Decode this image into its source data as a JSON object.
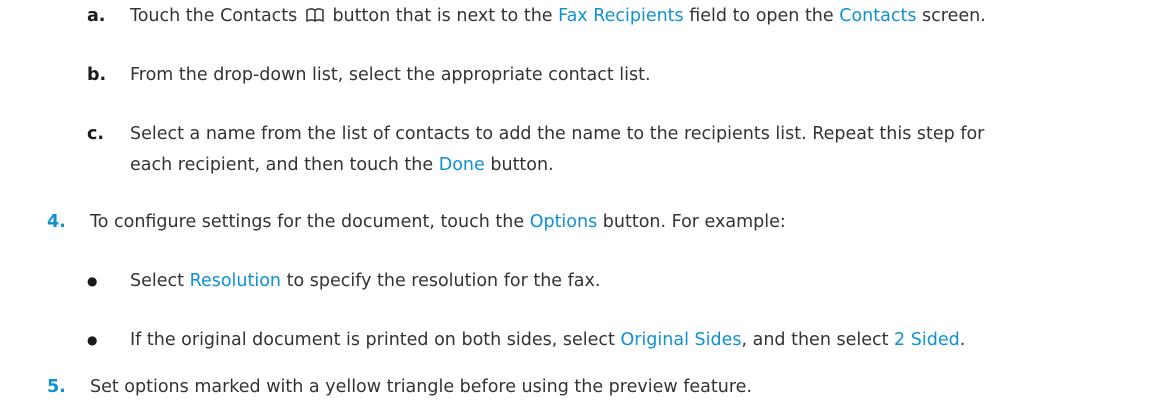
{
  "steps": {
    "a": {
      "marker": "a.",
      "t1": "Touch the Contacts",
      "t2": "button that is next to the",
      "link1": "Fax Recipients",
      "t3": "field to open the",
      "link2": "Contacts",
      "t4": "screen."
    },
    "b": {
      "marker": "b.",
      "text": "From the drop-down list, select the appropriate contact list."
    },
    "c": {
      "marker": "c.",
      "line1": "Select a name from the list of contacts to add the name to the recipients list. Repeat this step for",
      "line2_t1": "each recipient, and then touch the",
      "link": "Done",
      "line2_t2": "button."
    },
    "step4": {
      "marker": "4.",
      "t1": "To configure settings for the document, touch the",
      "link": "Options",
      "t2": "button. For example:"
    },
    "bullet1": {
      "marker": "●",
      "t1": "Select",
      "link": "Resolution",
      "t2": "to specify the resolution for the fax."
    },
    "bullet2": {
      "marker": "●",
      "t1": "If the original document is printed on both sides, select",
      "link1": "Original Sides",
      "t2": ", and then select",
      "link2": "2 Sided",
      "t3": "."
    },
    "step5": {
      "marker": "5.",
      "text": "Set options marked with a yellow triangle before using the preview feature."
    }
  },
  "icons": {
    "contacts": "book-icon"
  },
  "colors": {
    "link": "#0f91d2",
    "number": "#0f91d2",
    "body_text": "#333333"
  }
}
